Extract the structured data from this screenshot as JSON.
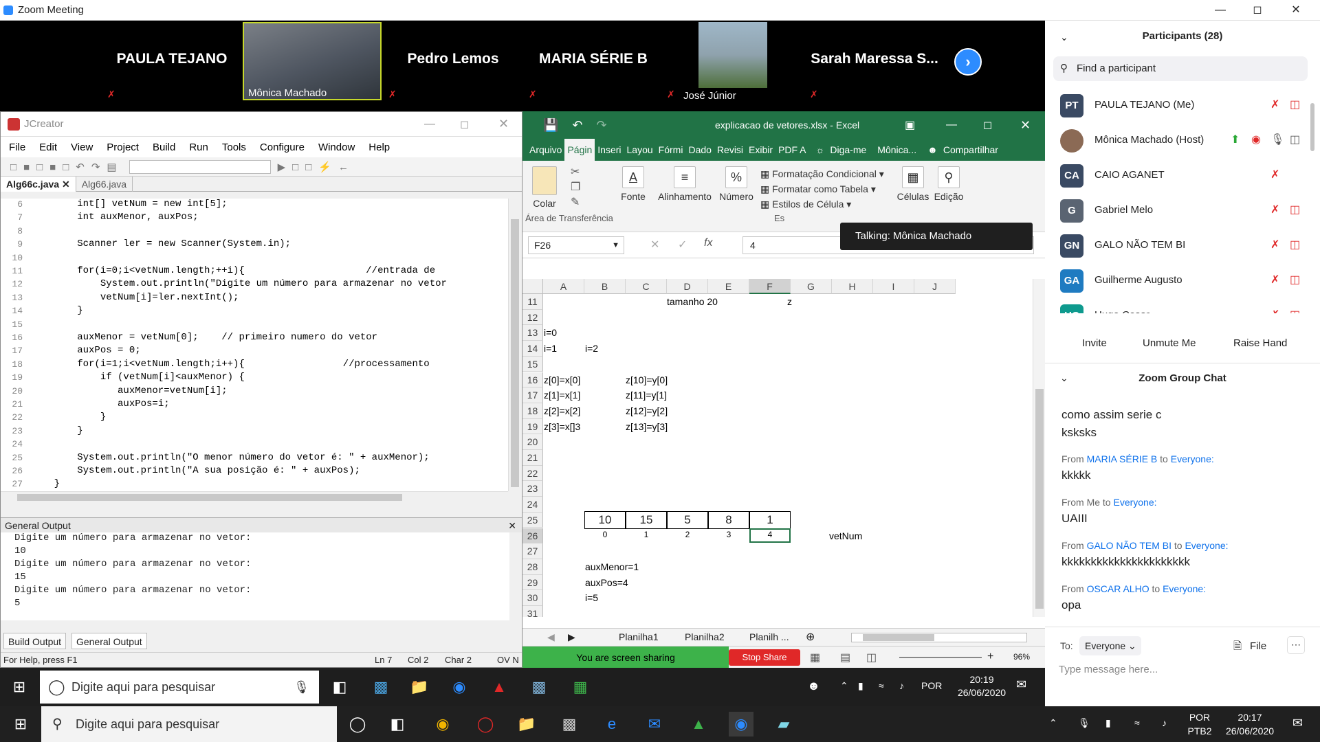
{
  "zoom": {
    "title": "Zoom Meeting",
    "gallery": [
      {
        "name": "PAULA TEJANO",
        "type": "name"
      },
      {
        "name": "Mônica Machado",
        "type": "video"
      },
      {
        "name": "Pedro Lemos",
        "type": "name"
      },
      {
        "name": "MARIA SÉRIE B",
        "type": "name"
      },
      {
        "name": "José Júnior",
        "type": "video"
      },
      {
        "name": "Sarah  Maressa  S...",
        "type": "name"
      }
    ],
    "participants_title": "Participants (28)",
    "search_placeholder": "Find a participant",
    "participants": [
      {
        "initials": "PT",
        "name": "PAULA TEJANO (Me)",
        "color": "#3a4a63"
      },
      {
        "initials": "",
        "name": "Mônica Machado (Host)",
        "color": "#8b6a55"
      },
      {
        "initials": "CA",
        "name": "CAIO AGANET",
        "color": "#3a4a63"
      },
      {
        "initials": "G",
        "name": "Gabriel Melo",
        "color": "#5a6472"
      },
      {
        "initials": "GN",
        "name": "GALO NÃO TEM BI",
        "color": "#3a4a63"
      },
      {
        "initials": "GA",
        "name": "Guilherme Augusto",
        "color": "#1f7bc1"
      },
      {
        "initials": "HC",
        "name": "Hugo Cesar",
        "color": "#0e9a8e"
      }
    ],
    "buttons": {
      "invite": "Invite",
      "unmute": "Unmute Me",
      "raise": "Raise Hand"
    },
    "chat_title": "Zoom Group Chat",
    "chat": [
      {
        "from": "",
        "to": "",
        "msg": "como assim serie c"
      },
      {
        "from": "",
        "to": "",
        "msg": "ksksks"
      },
      {
        "from": "MARIA SÉRIE B",
        "to": "Everyone:",
        "msg": "kkkkk"
      },
      {
        "from": "Me",
        "to": "Everyone:",
        "msg": "UAIII"
      },
      {
        "from": "GALO NÃO TEM BI",
        "to": "Everyone:",
        "msg": "kkkkkkkkkkkkkkkkkkkkkk"
      },
      {
        "from": "OSCAR ALHO",
        "to": "Everyone:",
        "msg": "opa"
      }
    ],
    "chat_to_label": "To:",
    "chat_to_value": "Everyone",
    "file_label": "File",
    "type_placeholder": "Type message here...",
    "talking": "Talking: Mônica Machado"
  },
  "jcreator": {
    "title": "JCreator",
    "menu": [
      "File",
      "Edit",
      "View",
      "Project",
      "Build",
      "Run",
      "Tools",
      "Configure",
      "Window",
      "Help"
    ],
    "tabs": [
      "Alg66c.java",
      "Alg66.java"
    ],
    "code": [
      {
        "n": "6",
        "t": "        int[] vetNum = new int[5];"
      },
      {
        "n": "7",
        "t": "        int auxMenor, auxPos;"
      },
      {
        "n": "8",
        "t": ""
      },
      {
        "n": "9",
        "t": "        Scanner ler = new Scanner(System.in);"
      },
      {
        "n": "10",
        "t": ""
      },
      {
        "n": "11",
        "t": "        for(i=0;i<vetNum.length;++i){                     //entrada de"
      },
      {
        "n": "12",
        "t": "            System.out.println(\"Digite um número para armazenar no vetor"
      },
      {
        "n": "13",
        "t": "            vetNum[i]=ler.nextInt();"
      },
      {
        "n": "14",
        "t": "        }"
      },
      {
        "n": "15",
        "t": ""
      },
      {
        "n": "16",
        "t": "        auxMenor = vetNum[0];    // primeiro numero do vetor"
      },
      {
        "n": "17",
        "t": "        auxPos = 0;"
      },
      {
        "n": "18",
        "t": "        for(i=1;i<vetNum.length;i++){                 //processamento"
      },
      {
        "n": "19",
        "t": "            if (vetNum[i]<auxMenor) {"
      },
      {
        "n": "20",
        "t": "               auxMenor=vetNum[i];"
      },
      {
        "n": "21",
        "t": "               auxPos=i;"
      },
      {
        "n": "22",
        "t": "            }"
      },
      {
        "n": "23",
        "t": "        }"
      },
      {
        "n": "24",
        "t": ""
      },
      {
        "n": "25",
        "t": "        System.out.println(\"O menor número do vetor é: \" + auxMenor);"
      },
      {
        "n": "26",
        "t": "        System.out.println(\"A sua posição é: \" + auxPos);"
      },
      {
        "n": "27",
        "t": "    }"
      },
      {
        "n": "28",
        "t": ""
      }
    ],
    "output_title": "General Output",
    "output": [
      "Digite um número para armazenar no vetor:",
      "10",
      "Digite um número para armazenar no vetor:",
      "15",
      "Digite um número para armazenar no vetor:",
      "5"
    ],
    "bottom_tabs": [
      "Build Output",
      "General Output"
    ],
    "status": {
      "help": "For Help, press F1",
      "ln": "Ln 7",
      "col": "Col 2",
      "char": "Char 2",
      "ovr": "OV N"
    }
  },
  "excel": {
    "title": "explicacao de vetores.xlsx - Excel",
    "tabs": [
      "Arquivo",
      "Págin",
      "Inseri",
      "Layou",
      "Fórmi",
      "Dado",
      "Revisi",
      "Exibir",
      "PDF A",
      "Diga-me",
      "Mônica...",
      "Compartilhar"
    ],
    "ribbon": {
      "colar": "Colar",
      "clip": "Área de Transferência",
      "fonte": "Fonte",
      "alin": "Alinhamento",
      "num": "Número",
      "cond": "Formatação Condicional",
      "tabela": "Formatar como Tabela",
      "estilos": "Estilos de Célula",
      "estilos_grp": "Es",
      "celulas": "Células",
      "edicao": "Edição"
    },
    "namebox": "F26",
    "formula": "4",
    "columns": [
      "A",
      "B",
      "C",
      "D",
      "E",
      "F",
      "G",
      "H",
      "I",
      "J"
    ],
    "rows": [
      "11",
      "12",
      "13",
      "14",
      "15",
      "16",
      "17",
      "18",
      "19",
      "20",
      "21",
      "22",
      "23",
      "24",
      "25",
      "26",
      "27",
      "28",
      "29",
      "30",
      "31"
    ],
    "cells": {
      "r11c": "tamanho 20",
      "r11f": "z",
      "r13a": "i=0",
      "r14a": "i=1",
      "r14b": "i=2",
      "r16a": "z[0]=x[0]",
      "r16c": "z[10]=y[0]",
      "r17a": "z[1]=x[1]",
      "r17c": "z[11]=y[1]",
      "r18a": "z[2]=x[2]",
      "r18c": "z[12]=y[2]",
      "r19a": "z[3]=x[]3",
      "r19c": "z[13]=y[3]",
      "vetnum": "vetNum",
      "r28": "auxMenor=1",
      "r29": "auxPos=4",
      "r30": "i=5"
    },
    "array_values": [
      "10",
      "15",
      "5",
      "8",
      "1"
    ],
    "array_index": [
      "0",
      "1",
      "2",
      "3",
      "4"
    ],
    "sheets": [
      "Planilha1",
      "Planilha2",
      "Planilh ..."
    ],
    "sharing": "You are screen sharing",
    "stop_share": "Stop Share",
    "zoom_pct": "96%"
  },
  "taskbar1": {
    "search": "Digite aqui para pesquisar",
    "lang": "POR",
    "time": "20:19",
    "date": "26/06/2020"
  },
  "taskbar2": {
    "search": "Digite aqui para pesquisar",
    "lang": "POR",
    "lang2": "PTB2",
    "time": "20:17",
    "date": "26/06/2020"
  }
}
